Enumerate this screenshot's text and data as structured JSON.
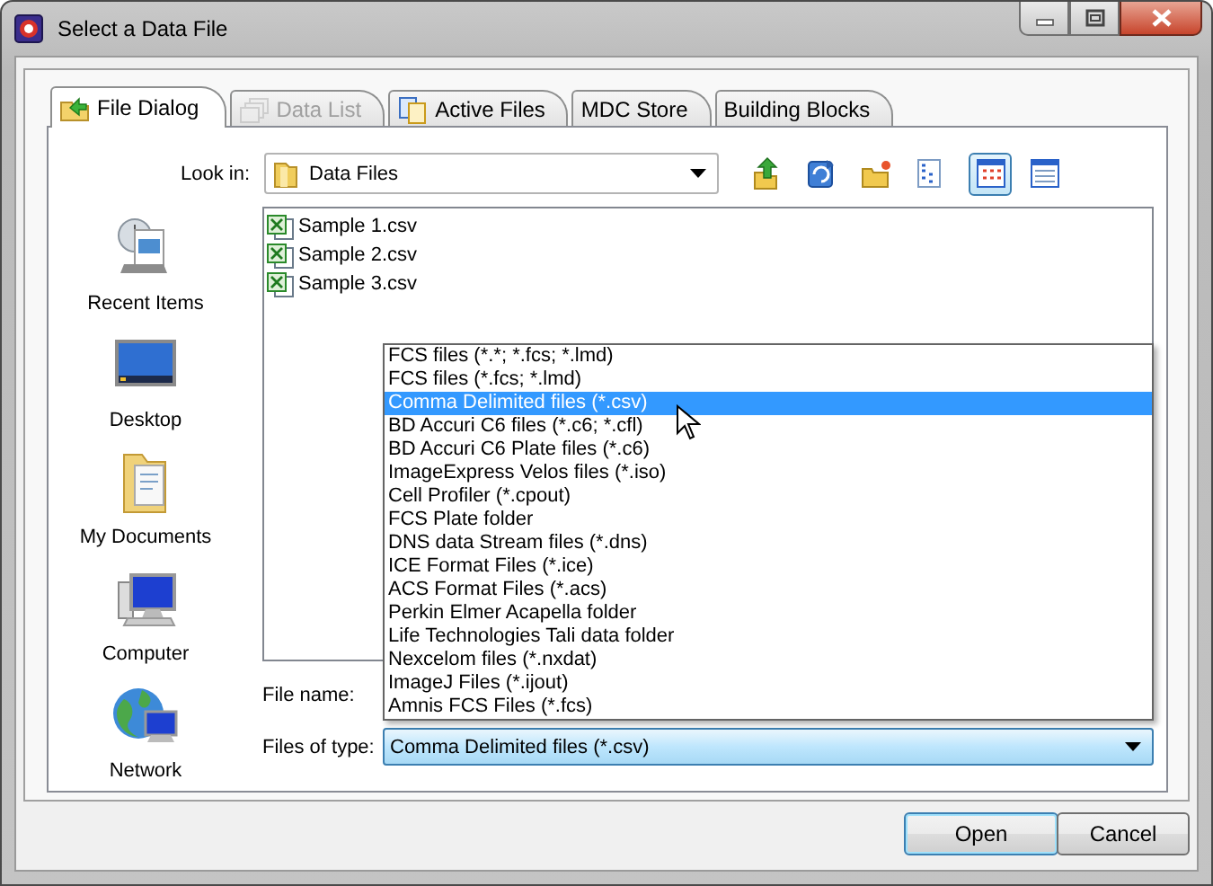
{
  "window": {
    "title": "Select a Data File"
  },
  "tabs": [
    {
      "label": "File Dialog",
      "kind": "folder",
      "selected": true,
      "disabled": false
    },
    {
      "label": "Data List",
      "kind": "stack",
      "selected": false,
      "disabled": true
    },
    {
      "label": "Active Files",
      "kind": "documents",
      "selected": false,
      "disabled": false
    },
    {
      "label": "MDC Store",
      "kind": "text",
      "selected": false,
      "disabled": false
    },
    {
      "label": "Building Blocks",
      "kind": "text",
      "selected": false,
      "disabled": false
    }
  ],
  "look_in": {
    "label": "Look in:",
    "value": "Data Files"
  },
  "toolbar": [
    {
      "kind": "up",
      "pressed": false
    },
    {
      "kind": "refresh",
      "pressed": false
    },
    {
      "kind": "new-folder",
      "pressed": false
    },
    {
      "kind": "list",
      "pressed": false
    },
    {
      "kind": "grid",
      "pressed": true
    },
    {
      "kind": "table",
      "pressed": false
    }
  ],
  "places": [
    {
      "label": "Recent Items",
      "kind": "recent"
    },
    {
      "label": "Desktop",
      "kind": "desktop"
    },
    {
      "label": "My Documents",
      "kind": "documents"
    },
    {
      "label": "Computer",
      "kind": "computer"
    },
    {
      "label": "Network",
      "kind": "network"
    }
  ],
  "files": [
    {
      "name": "Sample 1.csv"
    },
    {
      "name": "Sample 2.csv"
    },
    {
      "name": "Sample 3.csv"
    }
  ],
  "file_name": {
    "label": "File name:"
  },
  "file_type": {
    "label": "Files of type:",
    "value": "Comma Delimited files (*.csv)",
    "expanded": true,
    "options": [
      {
        "label": "FCS files (*.*; *.fcs; *.lmd)",
        "selected": false
      },
      {
        "label": "FCS files (*.fcs; *.lmd)",
        "selected": false
      },
      {
        "label": "Comma Delimited files (*.csv)",
        "selected": true
      },
      {
        "label": "BD Accuri C6 files (*.c6; *.cfl)",
        "selected": false
      },
      {
        "label": "BD Accuri C6 Plate files (*.c6)",
        "selected": false
      },
      {
        "label": "ImageExpress Velos files (*.iso)",
        "selected": false
      },
      {
        "label": "Cell Profiler (*.cpout)",
        "selected": false
      },
      {
        "label": "FCS Plate folder",
        "selected": false
      },
      {
        "label": "DNS data Stream files (*.dns)",
        "selected": false
      },
      {
        "label": "ICE Format Files (*.ice)",
        "selected": false
      },
      {
        "label": "ACS Format Files (*.acs)",
        "selected": false
      },
      {
        "label": "Perkin Elmer Acapella folder",
        "selected": false
      },
      {
        "label": "Life Technologies Tali data folder",
        "selected": false
      },
      {
        "label": "Nexcelom files (*.nxdat)",
        "selected": false
      },
      {
        "label": "ImageJ Files (*.ijout)",
        "selected": false
      },
      {
        "label": "Amnis FCS Files (*.fcs)",
        "selected": false
      }
    ]
  },
  "buttons": [
    {
      "label": "Open",
      "default": true
    },
    {
      "label": "Cancel",
      "default": false
    }
  ]
}
